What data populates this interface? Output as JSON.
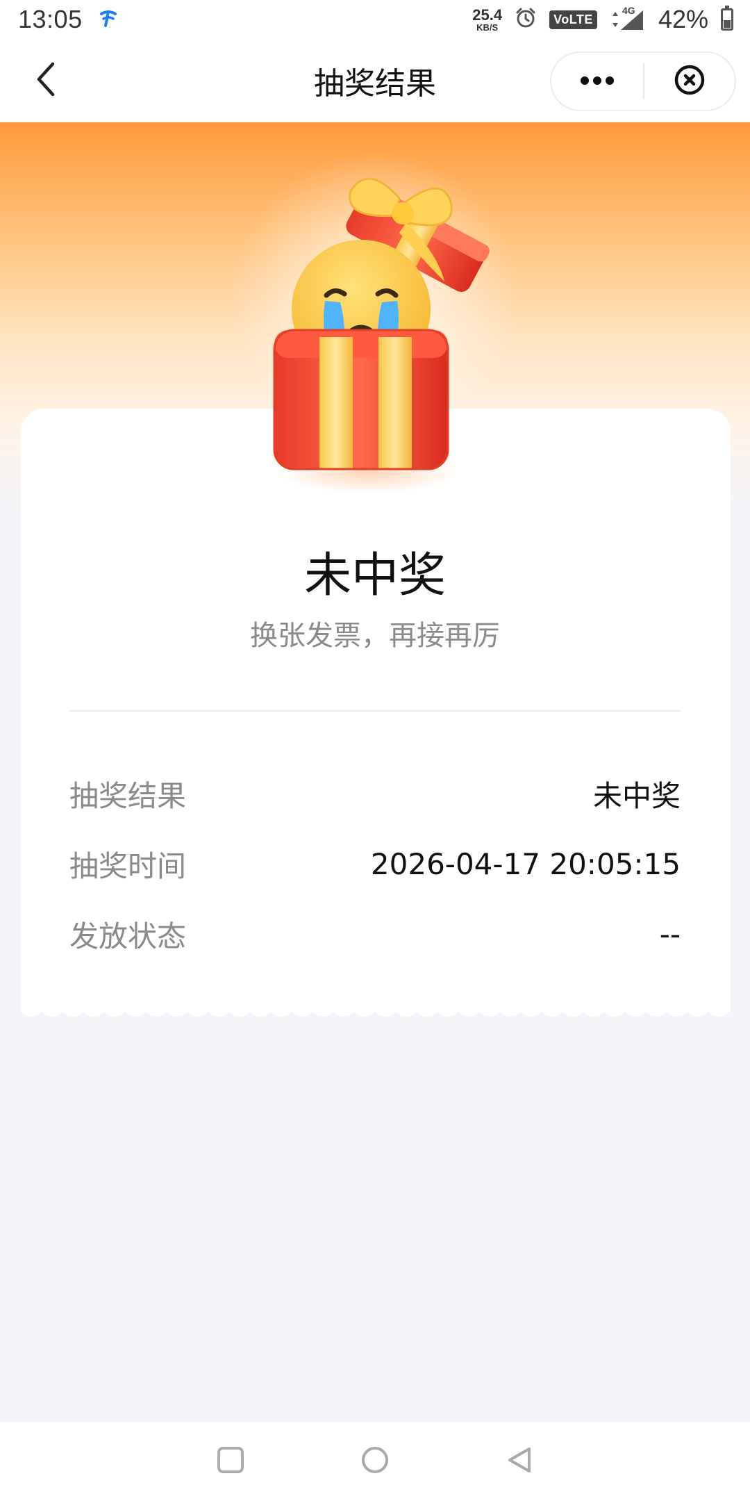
{
  "status_bar": {
    "time": "13:05",
    "net_speed_value": "25.4",
    "net_speed_unit": "KB/S",
    "volte": "VoLTE",
    "network": "4G",
    "battery": "42%"
  },
  "nav": {
    "title": "抽奖结果",
    "back_icon": "chevron-left-icon",
    "more_icon": "more-dots-icon",
    "close_icon": "close-circle-icon"
  },
  "result": {
    "title": "未中奖",
    "subtitle": "换张发票，再接再厉"
  },
  "details": [
    {
      "label": "抽奖结果",
      "value": "未中奖"
    },
    {
      "label": "抽奖时间",
      "value": "2026-04-17 20:05:15"
    },
    {
      "label": "发放状态",
      "value": "--"
    }
  ],
  "colors": {
    "banner_top": "#ff9a3c",
    "page_bg": "#f4f5f9",
    "muted_text": "#8a8a8a"
  }
}
